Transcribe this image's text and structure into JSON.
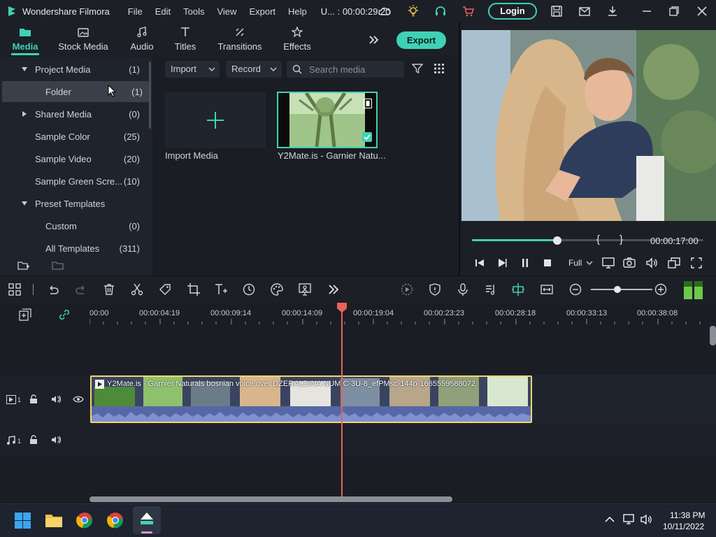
{
  "app": {
    "name": "Wondershare Filmora",
    "menu": [
      "File",
      "Edit",
      "Tools",
      "View",
      "Export",
      "Help"
    ],
    "project": "U... : 00:00:29:20",
    "login_label": "Login"
  },
  "tabs": [
    {
      "label": "Media",
      "icon": "folder-icon"
    },
    {
      "label": "Stock Media",
      "icon": "stock-media-icon"
    },
    {
      "label": "Audio",
      "icon": "music-note-icon"
    },
    {
      "label": "Titles",
      "icon": "text-icon"
    },
    {
      "label": "Transitions",
      "icon": "transitions-icon"
    },
    {
      "label": "Effects",
      "icon": "effects-icon"
    }
  ],
  "export_label": "Export",
  "library": [
    {
      "label": "Project Media",
      "count": "(1)"
    },
    {
      "label": "Folder",
      "count": "(1)"
    },
    {
      "label": "Shared Media",
      "count": "(0)"
    },
    {
      "label": "Sample Color",
      "count": "(25)"
    },
    {
      "label": "Sample Video",
      "count": "(20)"
    },
    {
      "label": "Sample Green Scre...",
      "count": "(10)"
    },
    {
      "label": "Preset Templates",
      "count": ""
    },
    {
      "label": "Custom",
      "count": "(0)"
    },
    {
      "label": "All Templates",
      "count": "(311)"
    }
  ],
  "media": {
    "import_label": "Import",
    "record_label": "Record",
    "search_placeholder": "Search media",
    "import_tile_label": "Import Media",
    "clip_label": "Y2Mate.is - Garnier Natu..."
  },
  "preview": {
    "timecode": "00:00:17:00",
    "progress": 0.37,
    "quality": "Full",
    "mark_in": "{",
    "mark_out": "}"
  },
  "timeline": {
    "ticks": [
      "00:00",
      "00:00:04:19",
      "00:00:09:14",
      "00:00:14:09",
      "00:00:19:04",
      "00:00:23:23",
      "00:00:28:18",
      "00:00:33:13",
      "00:00:38:08"
    ],
    "clip_title": "Y2Mate.is - Garnier Naturals bosnian voice over DZERALDINA NUMIC-3U-8_efPMsc-144p-1665559588072",
    "video_track": "1",
    "audio_track": "1"
  },
  "taskbar": {
    "time": "11:38 PM",
    "date": "10/11/2022"
  },
  "colors": {
    "accent": "#3fd1b5",
    "playhead": "#e8625a",
    "clip_border": "#f2d66b"
  }
}
